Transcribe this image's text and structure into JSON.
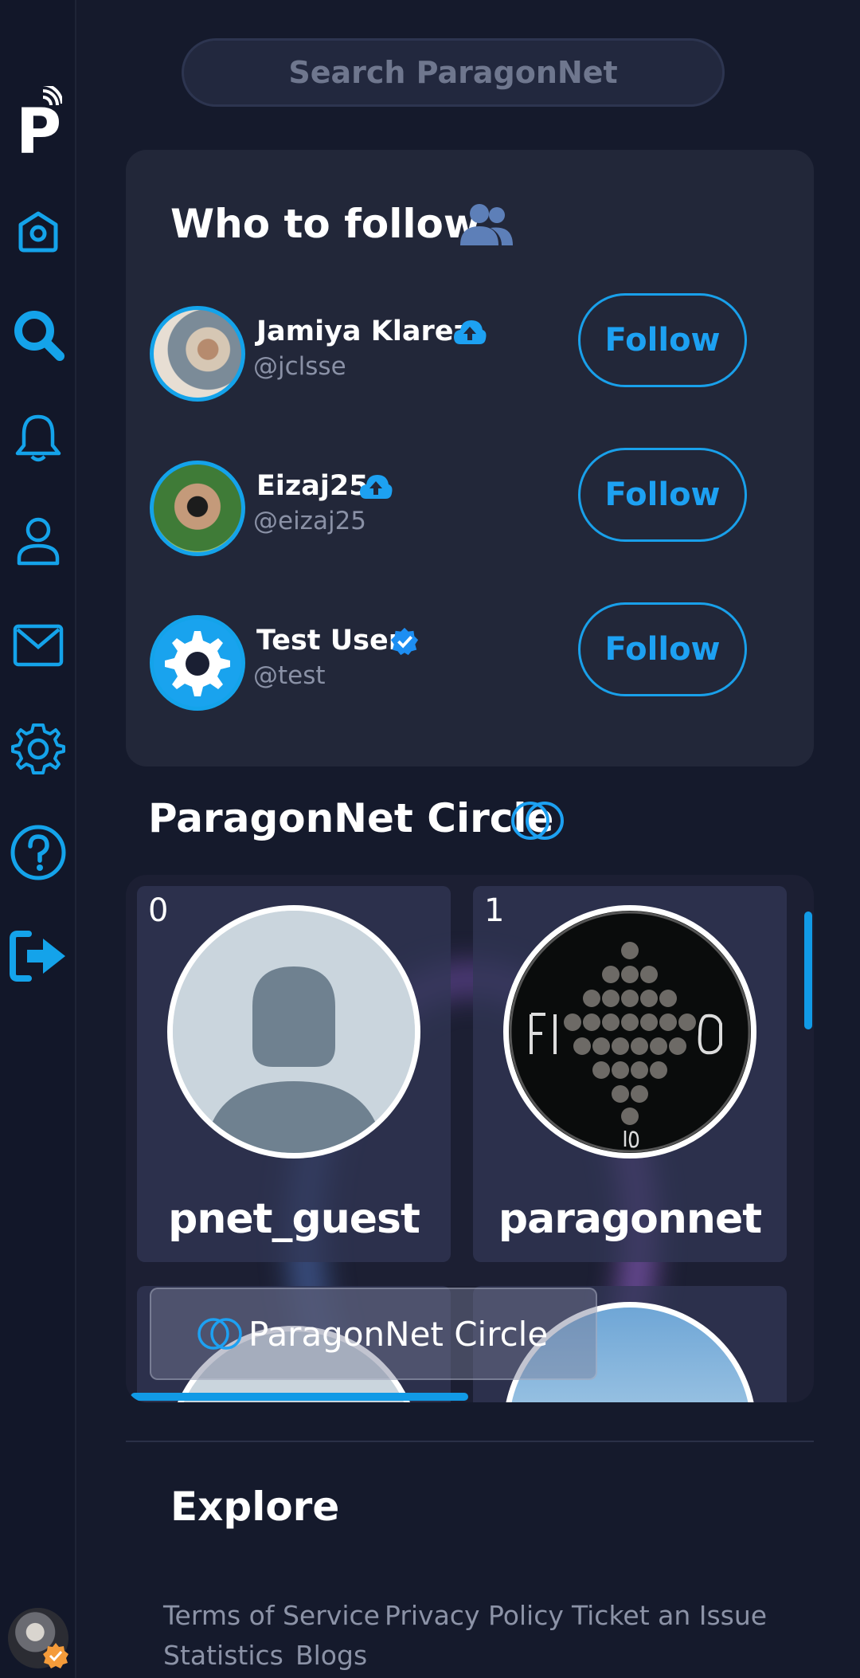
{
  "search": {
    "placeholder": "Search ParagonNet"
  },
  "sidebar": {
    "logo": "P",
    "items": [
      {
        "name": "home",
        "icon": "home-icon"
      },
      {
        "name": "search",
        "icon": "search-icon"
      },
      {
        "name": "notifications",
        "icon": "bell-icon"
      },
      {
        "name": "profile",
        "icon": "user-icon"
      },
      {
        "name": "messages",
        "icon": "mail-icon"
      },
      {
        "name": "settings",
        "icon": "gear-icon"
      },
      {
        "name": "help",
        "icon": "help-icon"
      },
      {
        "name": "logout",
        "icon": "logout-icon"
      }
    ],
    "accent": "#14a3ea"
  },
  "who_to_follow": {
    "title": "Who to follow",
    "users": [
      {
        "name": "Jamiya Klarez",
        "handle": "@jclsse",
        "badge": "cloud-upload-icon",
        "button": "Follow"
      },
      {
        "name": "Eizaj25",
        "handle": "@eizaj25",
        "badge": "cloud-upload-icon",
        "button": "Follow"
      },
      {
        "name": "Test User",
        "handle": "@test",
        "badge": "verified-icon",
        "button": "Follow"
      }
    ]
  },
  "circle": {
    "title": "ParagonNet Circle",
    "tiles": [
      {
        "index": "0",
        "name": "pnet_guest"
      },
      {
        "index": "1",
        "name": "paragonnet"
      }
    ],
    "chip_label": "ParagonNet Circle"
  },
  "explore": {
    "title": "Explore",
    "links": [
      "Terms of Service",
      "Privacy Policy",
      "Ticket an Issue",
      "Statistics",
      "Blogs"
    ]
  },
  "colors": {
    "background": "#151a2c",
    "card": "#222739",
    "accent": "#1da1f2",
    "muted": "#8a91a6"
  }
}
